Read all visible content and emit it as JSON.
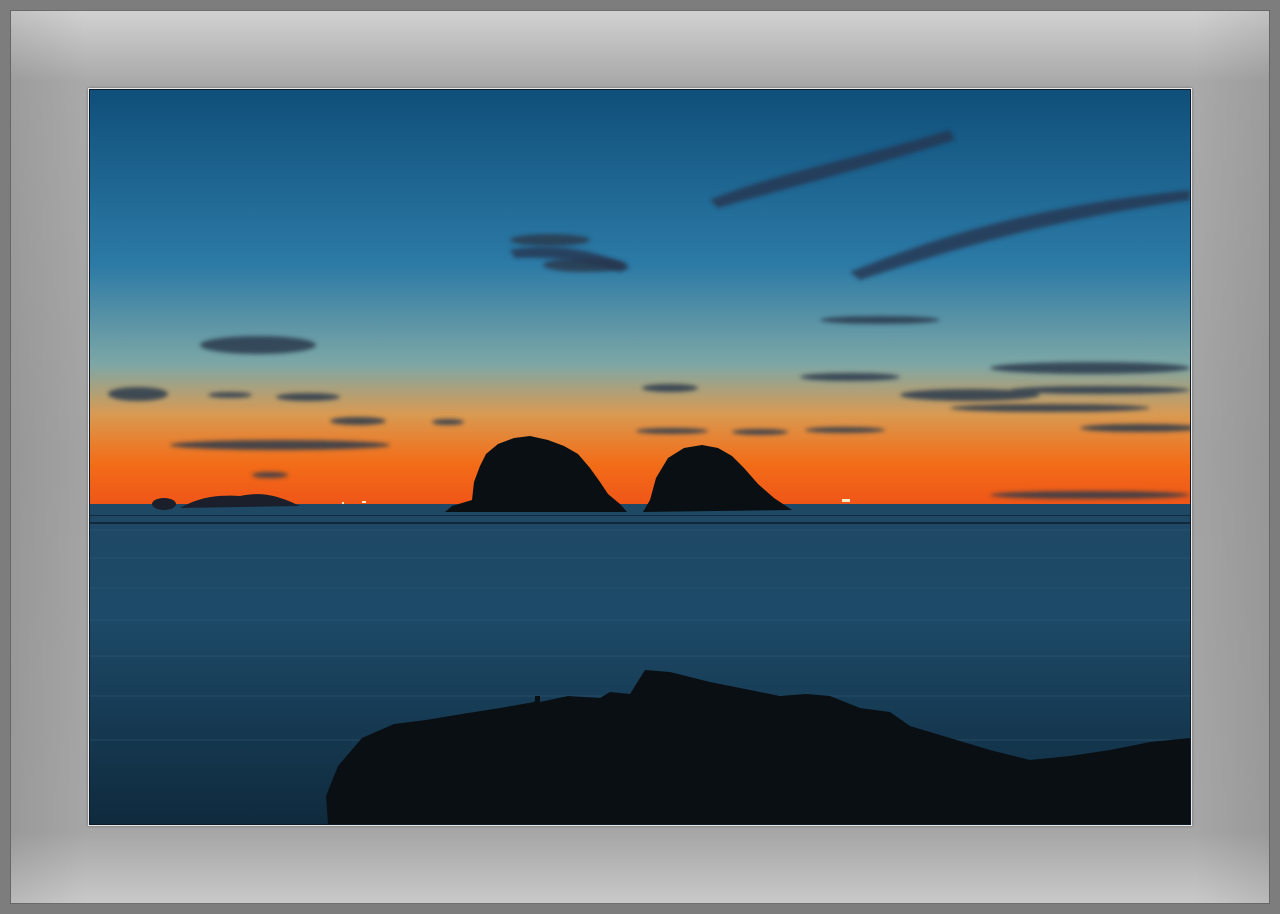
{
  "scene": {
    "subject": "sunset-over-sea-with-two-islets",
    "colors": {
      "sky_top": "#0f4f7a",
      "sky_mid": "#2c7aa6",
      "sky_haze": "#7da7a6",
      "horizon_orange": "#f06a14",
      "horizon_red": "#e84a12",
      "sea_top": "#1e4864",
      "sea_bottom": "#0f2a3d",
      "silhouette": "#0a0f14",
      "mat_light": "#d2d2d2",
      "mat_mid": "#a3a3a3"
    }
  }
}
